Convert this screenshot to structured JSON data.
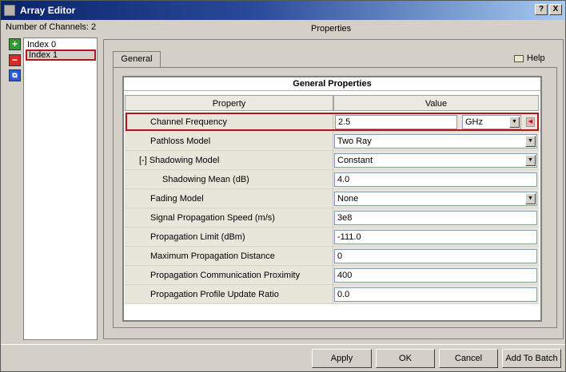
{
  "window": {
    "title": "Array Editor",
    "help_btn": "?",
    "close_btn": "X"
  },
  "channels": {
    "count_label": "Number of Channels: 2",
    "items": [
      "Index 0",
      "Index 1"
    ],
    "selected": "Index 1",
    "add_glyph": "+",
    "remove_glyph": "−",
    "duplicate_glyph": "⧉"
  },
  "properties": {
    "heading": "Properties",
    "tab": "General",
    "help_link": "Help",
    "frame_title": "General Properties",
    "col_property": "Property",
    "col_value": "Value",
    "rows": [
      {
        "name": "Channel Frequency",
        "value": "2.5",
        "unit": "GHz"
      },
      {
        "name": "Pathloss Model",
        "value": "Two Ray"
      },
      {
        "name": "[-] Shadowing Model",
        "value": "Constant"
      },
      {
        "name": "Shadowing Mean (dB)",
        "value": "4.0"
      },
      {
        "name": "Fading Model",
        "value": "None"
      },
      {
        "name": "Signal Propagation Speed (m/s)",
        "value": "3e8"
      },
      {
        "name": "Propagation Limit (dBm)",
        "value": "-111.0"
      },
      {
        "name": "Maximum Propagation Distance",
        "value": "0"
      },
      {
        "name": "Propagation Communication Proximity",
        "value": "400"
      },
      {
        "name": "Propagation Profile Update Ratio",
        "value": "0.0"
      }
    ]
  },
  "buttons": {
    "apply": "Apply",
    "ok": "OK",
    "cancel": "Cancel",
    "add_to_batch": "Add To Batch"
  },
  "colors": {
    "highlight": "#b4141e",
    "titlebar_start": "#0a246a",
    "titlebar_end": "#a6caf0"
  },
  "dropdown_arrow": "▼",
  "side_arrow": "◀"
}
